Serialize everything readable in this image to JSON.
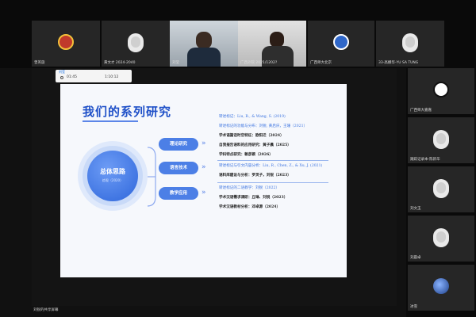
{
  "participants_top": [
    {
      "name": "曾英旋",
      "type": "logo"
    },
    {
      "name": "黄文才 2024-2040",
      "type": "avatar"
    },
    {
      "name": "刘莹",
      "type": "video"
    },
    {
      "name": "广西外院 2021/1202?",
      "type": "video"
    },
    {
      "name": "广西师大北京",
      "type": "logo"
    },
    {
      "name": "33-高娜华-YU SA TUNG",
      "type": "avatar"
    }
  ],
  "participants_side": [
    {
      "name": "广西师大嘉嘉",
      "type": "logo"
    },
    {
      "name": "跟踪记录本-陈新华",
      "type": "avatar"
    },
    {
      "name": "刘文玉",
      "type": "avatar"
    },
    {
      "name": "刘晨卓",
      "type": "avatar"
    },
    {
      "name": "冰雪",
      "type": "globe"
    }
  ],
  "timebar": {
    "title": "刘莹",
    "elapsed": "01:45",
    "total": "1:10:12"
  },
  "slide": {
    "title": "我们的系列研究",
    "center_main": "总体思路",
    "center_sub": "综观（2020）",
    "pills": [
      "理论研究",
      "语言技术",
      "教学应用"
    ],
    "refs": [
      {
        "text": "转述标记：Liu, R., & Wang, S. (2019)",
        "style": "blue"
      },
      {
        "text": "转述标记的功能与分布：刘锐, 黄启庆，王珊（2021）",
        "style": "blue"
      },
      {
        "text": "学术语篇话时空特征：欧阳迁（2024）",
        "style": "dark"
      },
      {
        "text": "自我报告语料的应用研究：黄子晨（2025）",
        "style": "dark"
      },
      {
        "text": "学科特点研究：赖彦颖（2026）",
        "style": "dark"
      },
      {
        "text": "转述标记与引文内容分析：Liu, R., Chen, Z., & Xu, J. (2021)",
        "style": "blue"
      },
      {
        "text": "语料库建设与分析：罗灵子，刘锐（2023）",
        "style": "dark"
      },
      {
        "text": "转述标记的二语教学：刘锐（2022）",
        "style": "blue"
      },
      {
        "text": "学术汉语需求调研：丘琳、刘锐（2023）",
        "style": "dark"
      },
      {
        "text": "学术汉语教材分析：邓卓源（2024）",
        "style": "dark"
      }
    ]
  },
  "self_name": "刘锐的共享屏幕",
  "colors": {
    "accent": "#1f50c8",
    "pill": "#4c7fe6",
    "ref_blue": "#3b73e0"
  }
}
